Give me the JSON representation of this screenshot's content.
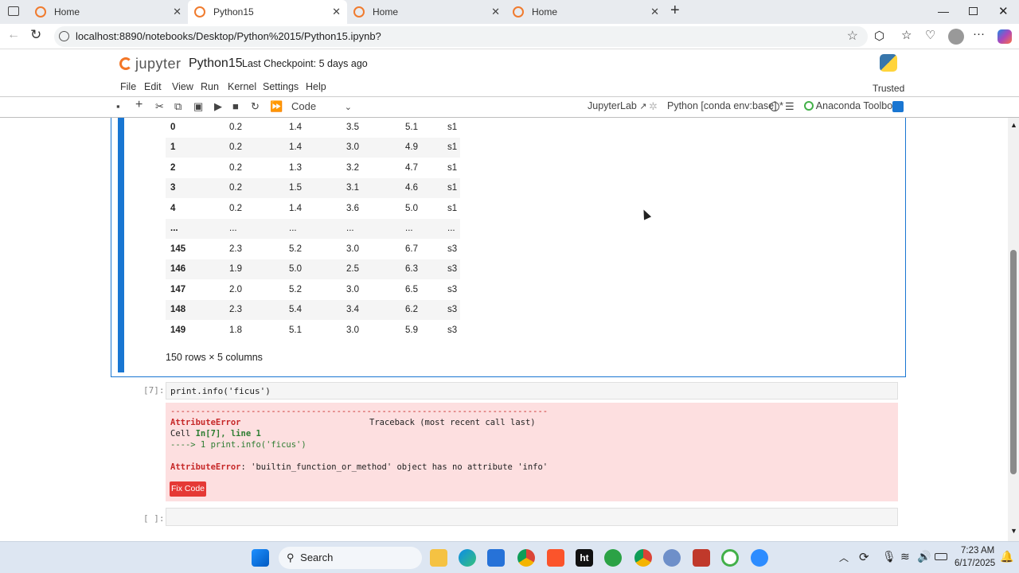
{
  "browser": {
    "tabs": [
      {
        "label": "Home"
      },
      {
        "label": "Python15"
      },
      {
        "label": "Home"
      },
      {
        "label": "Home"
      }
    ],
    "url": "localhost:8890/notebooks/Desktop/Python%2015/Python15.ipynb?"
  },
  "jupyter": {
    "logo": "jupyter",
    "notebook_name": "Python15",
    "checkpoint": "Last Checkpoint: 5 days ago",
    "trusted": "Trusted",
    "menu": [
      "File",
      "Edit",
      "View",
      "Run",
      "Kernel",
      "Settings",
      "Help"
    ],
    "cell_type": "Code",
    "jupyterlab_link": "JupyterLab",
    "kernel": "Python [conda env:base] *",
    "anaconda": "Anaconda Toolbox"
  },
  "output": {
    "rows": [
      [
        "0",
        "0.2",
        "1.4",
        "3.5",
        "5.1",
        "s1"
      ],
      [
        "1",
        "0.2",
        "1.4",
        "3.0",
        "4.9",
        "s1"
      ],
      [
        "2",
        "0.2",
        "1.3",
        "3.2",
        "4.7",
        "s1"
      ],
      [
        "3",
        "0.2",
        "1.5",
        "3.1",
        "4.6",
        "s1"
      ],
      [
        "4",
        "0.2",
        "1.4",
        "3.6",
        "5.0",
        "s1"
      ],
      [
        "...",
        "...",
        "...",
        "...",
        "...",
        "..."
      ],
      [
        "145",
        "2.3",
        "5.2",
        "3.0",
        "6.7",
        "s3"
      ],
      [
        "146",
        "1.9",
        "5.0",
        "2.5",
        "6.3",
        "s3"
      ],
      [
        "147",
        "2.0",
        "5.2",
        "3.0",
        "6.5",
        "s3"
      ],
      [
        "148",
        "2.3",
        "5.4",
        "3.4",
        "6.2",
        "s3"
      ],
      [
        "149",
        "1.8",
        "5.1",
        "3.0",
        "5.9",
        "s3"
      ]
    ],
    "row_count": "150 rows × 5 columns"
  },
  "cell7": {
    "prompt": "[7]:",
    "code": "print.info('ficus')",
    "error_rule": "---------------------------------------------------------------------------",
    "error_name": "AttributeError",
    "traceback": "Traceback (most recent call last)",
    "cell_ref_prefix": "Cell ",
    "cell_ref_bold": "In[7], line 1",
    "arrow_line": "----> 1 print.info('ficus')",
    "message": ": 'builtin_function_or_method' object has no attribute 'info'",
    "fix_button": "Fix Code"
  },
  "cell_empty": {
    "prompt": "[ ]:"
  },
  "taskbar": {
    "search": "Search",
    "time": "7:23 AM",
    "date": "6/17/2025"
  }
}
